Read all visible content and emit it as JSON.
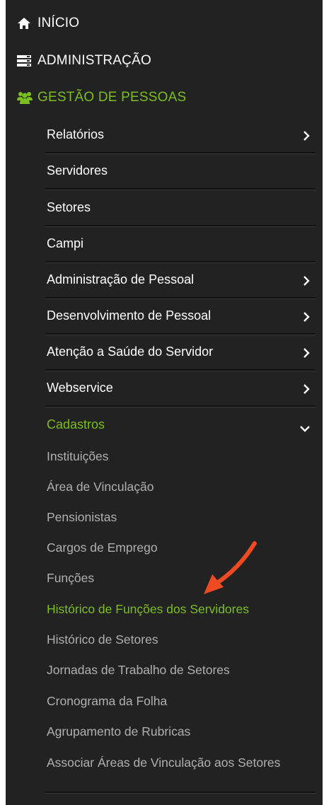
{
  "colors": {
    "sidebar_bg": "#222222",
    "active": "#7bbf1e",
    "text": "#ffffff",
    "muted": "#b0b0b0",
    "arrow": "#ee4b24"
  },
  "menu": {
    "top": [
      {
        "label": "INÍCIO",
        "icon": "home-icon"
      },
      {
        "label": "ADMINISTRAÇÃO",
        "icon": "server-icon"
      },
      {
        "label": "GESTÃO DE PESSOAS",
        "icon": "users-icon",
        "active": true
      }
    ],
    "submenu": [
      {
        "label": "Relatórios",
        "has_children": true
      },
      {
        "label": "Servidores",
        "has_children": false
      },
      {
        "label": "Setores",
        "has_children": false
      },
      {
        "label": "Campi",
        "has_children": false
      },
      {
        "label": "Administração de Pessoal",
        "has_children": true
      },
      {
        "label": "Desenvolvimento de Pessoal",
        "has_children": true
      },
      {
        "label": "Atenção a Saúde do Servidor",
        "has_children": true
      },
      {
        "label": "Webservice",
        "has_children": true
      },
      {
        "label": "Cadastros",
        "has_children": true,
        "expanded": true,
        "active": true
      }
    ],
    "cadastros_items": [
      {
        "label": "Instituições"
      },
      {
        "label": "Área de Vinculação"
      },
      {
        "label": "Pensionistas"
      },
      {
        "label": "Cargos de Emprego"
      },
      {
        "label": "Funções"
      },
      {
        "label": "Histórico de Funções dos Servidores",
        "active": true
      },
      {
        "label": "Histórico de Setores"
      },
      {
        "label": "Jornadas de Trabalho de Setores"
      },
      {
        "label": "Cronograma da Folha"
      },
      {
        "label": "Agrupamento de Rubricas"
      },
      {
        "label": "Associar Áreas de Vinculação aos Setores"
      }
    ]
  },
  "annotation": {
    "icon": "red-arrow-icon"
  }
}
